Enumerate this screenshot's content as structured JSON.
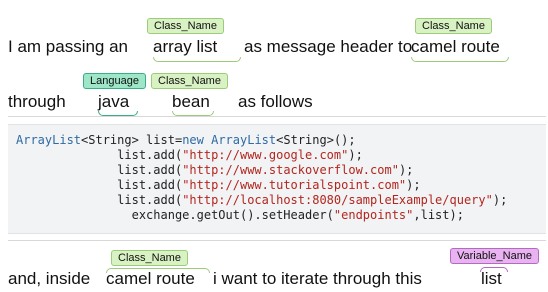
{
  "top": {
    "line1": {
      "words": [
        "I am passing an",
        "array list",
        "as message header to",
        "camel route"
      ],
      "tags": [
        "Class_Name",
        "Class_Name"
      ]
    },
    "line2": {
      "words": [
        "through",
        "java",
        "bean",
        "as follows"
      ],
      "tags": [
        "Language",
        "Class_Name"
      ]
    }
  },
  "code": {
    "lines": [
      {
        "type": "decl",
        "kw1": "ArrayList",
        "t1": "<String>",
        "mid": " list=",
        "new": "new",
        "kw2": "ArrayList",
        "t2": "<String>",
        "end": "();"
      },
      {
        "type": "add",
        "indent": "              ",
        "pre": "list.add(",
        "str": "\"http://www.google.com\"",
        "post": ");"
      },
      {
        "type": "add",
        "indent": "              ",
        "pre": "list.add(",
        "str": "\"http://www.stackoverflow.com\"",
        "post": ");"
      },
      {
        "type": "add",
        "indent": "              ",
        "pre": "list.add(",
        "str": "\"http://www.tutorialspoint.com\"",
        "post": ");"
      },
      {
        "type": "add",
        "indent": "              ",
        "pre": "list.add(",
        "str": "\"http://localhost:8080/sampleExample/query\"",
        "post": ");"
      },
      {
        "type": "add",
        "indent": "                ",
        "pre": "exchange.getOut().setHeader(",
        "str": "\"endpoints\"",
        "post": ",list);"
      }
    ]
  },
  "bottom": {
    "words": [
      "and, inside",
      "camel route",
      "i want to iterate through this",
      "list"
    ],
    "tags": [
      "Class_Name",
      "Variable_Name"
    ]
  }
}
